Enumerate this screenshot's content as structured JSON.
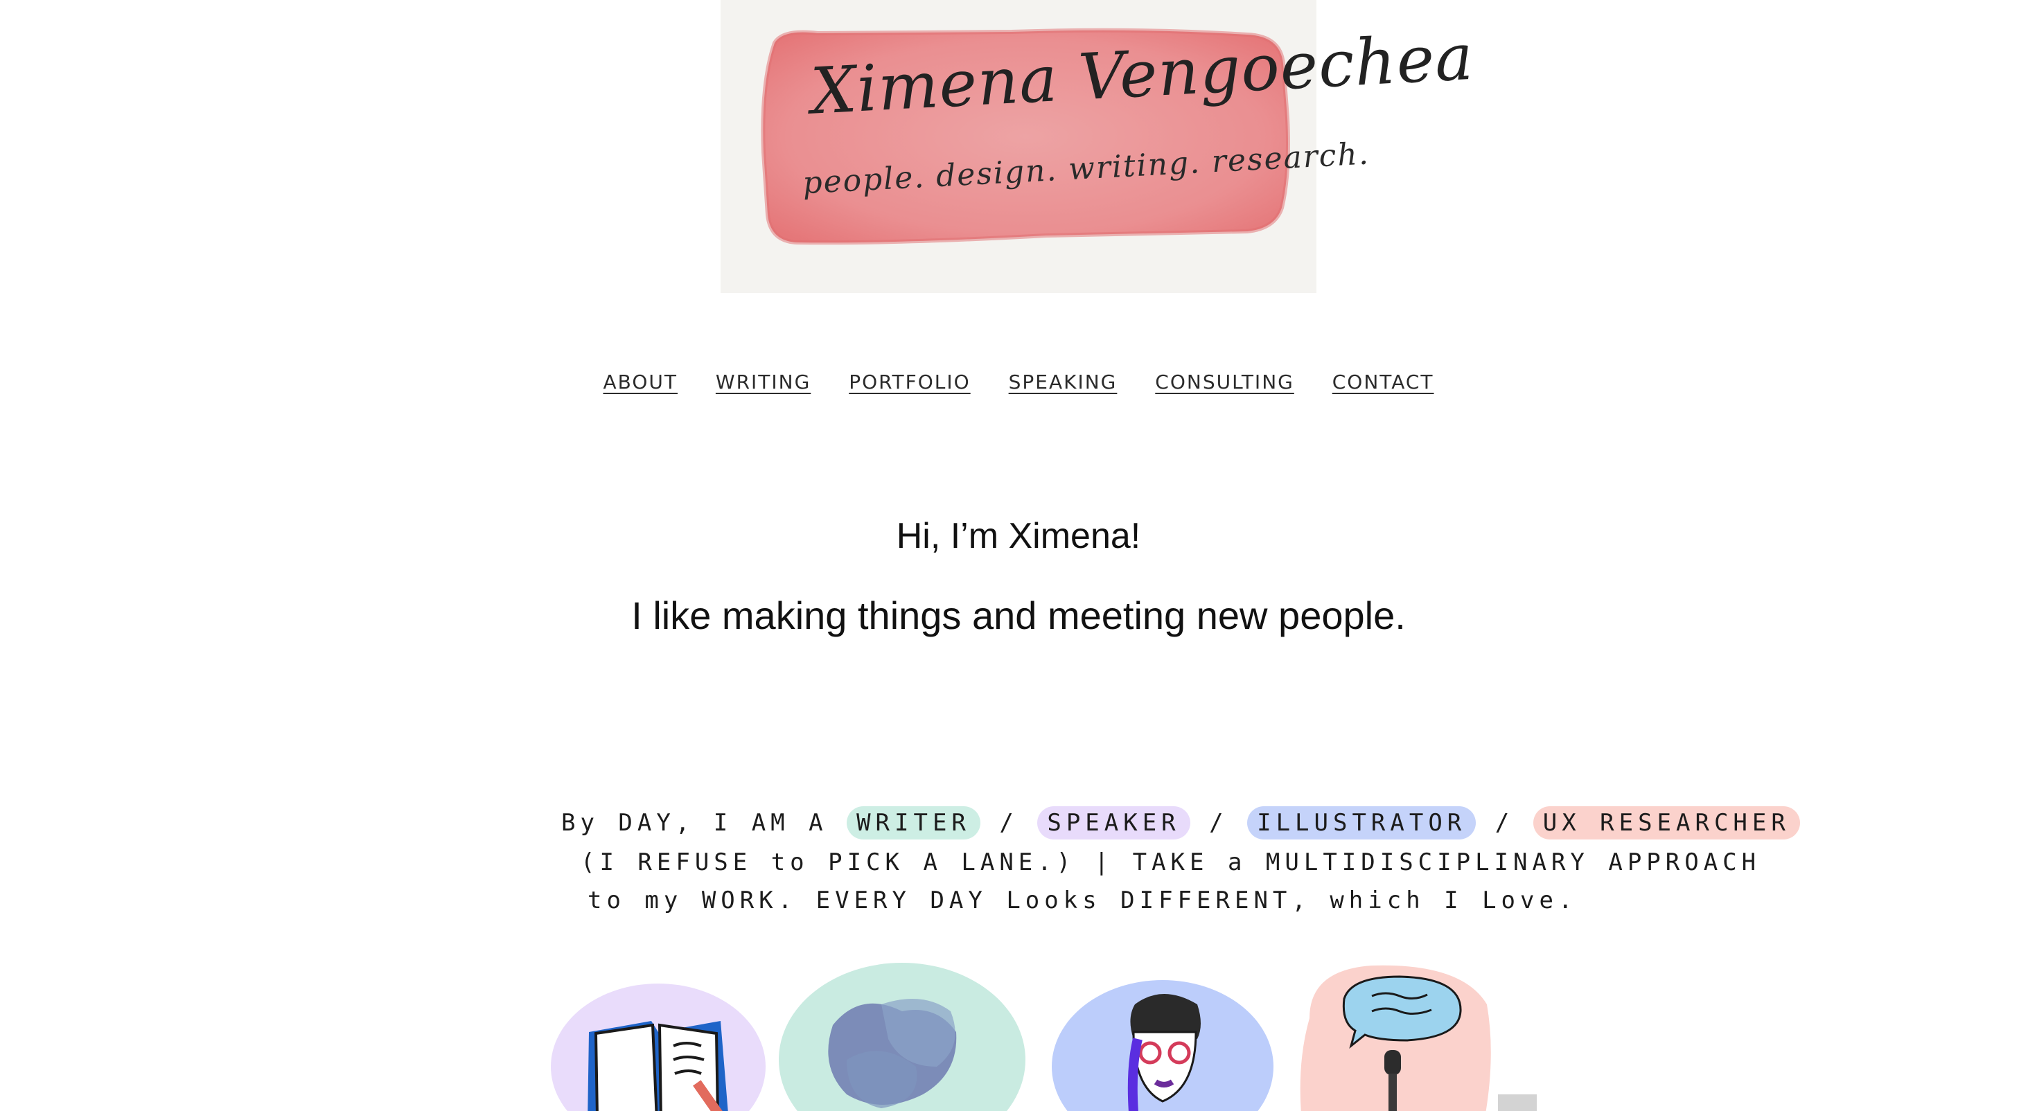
{
  "header": {
    "logo_name": "Ximena Vengoechea",
    "logo_tagline": "people. design. writing. research."
  },
  "nav": {
    "items": [
      "ABOUT",
      "WRITING",
      "PORTFOLIO",
      "SPEAKING",
      "CONSULTING",
      "CONTACT"
    ]
  },
  "intro": {
    "greeting": "Hi, I’m Ximena!",
    "subtitle": "I like making things and meeting new people."
  },
  "description": {
    "line1_prefix": "By DAY, I AM A",
    "writer": "WRITER",
    "speaker": "SPEAKER",
    "illustrator": "ILLUSTRATOR",
    "ux": "UX RESEARCHER",
    "sep": "/",
    "line2": "(I REFUSE to PICK A LANE.) | TAKE a MULTIDISCIPLINARY APPROACH",
    "line3": "to my WORK. EVERY DAY Looks DIFFERENT, which I Love."
  },
  "colors": {
    "logo_pink": "#ea8a8c",
    "writer_hl": "#cdeee4",
    "speaker_hl": "#e8dbfb",
    "illustrator_hl": "#c5d3fa",
    "ux_hl": "#fbd2cc"
  },
  "illustrations": [
    "book-icon",
    "paint-blob-icon",
    "woman-glasses-icon",
    "microphone-speech-icon"
  ]
}
